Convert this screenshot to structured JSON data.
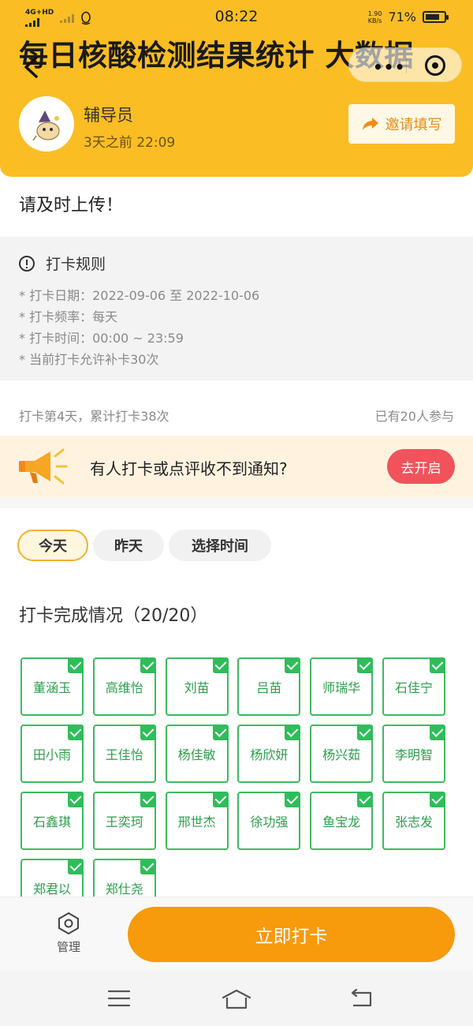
{
  "status_bar": {
    "network": "4G+HD",
    "time": "08:22",
    "speed_value": "1.90",
    "speed_unit": "KB/s",
    "battery": "71%"
  },
  "header": {
    "title": "每日核酸检测结果统计 大数据",
    "author": "辅导员",
    "time": "3天之前 22:09",
    "invite_label": "邀请填写"
  },
  "notice": "请及时上传！",
  "rules": {
    "heading": "打卡规则",
    "lines": [
      "* 打卡日期：2022-09-06 至 2022-10-06",
      "* 打卡频率：每天",
      "* 打卡时间：00:00 ~ 23:59",
      "* 当前打卡允许补卡30次"
    ]
  },
  "stats": {
    "summary": "打卡第4天，累计打卡38次",
    "participants": "已有20人参与"
  },
  "notify": {
    "text": "有人打卡或点评收不到通知?",
    "button": "去开启"
  },
  "tabs": [
    "今天",
    "昨天",
    "选择时间"
  ],
  "section_title": "打卡完成情况（20/20）",
  "members": [
    "董涵玉",
    "高维怡",
    "刘苗",
    "吕苗",
    "师瑞华",
    "石佳宁",
    "田小雨",
    "王佳怡",
    "杨佳敏",
    "杨欣妍",
    "杨兴茹",
    "李明智",
    "石鑫琪",
    "王奕珂",
    "邢世杰",
    "徐功强",
    "鱼宝龙",
    "张志发",
    "郑君以",
    "郑仕尧"
  ],
  "bottom": {
    "manage_label": "管理",
    "checkin_label": "立即打卡"
  },
  "colors": {
    "header_bg": "#fbbd24",
    "check_green": "#2fbd5a",
    "checkin_orange": "#f79a0c",
    "notify_red": "#f0535b"
  }
}
